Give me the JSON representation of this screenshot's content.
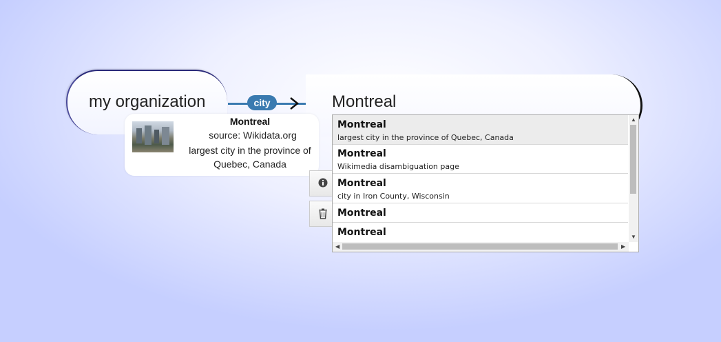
{
  "source_node": {
    "label": "my organization"
  },
  "edge": {
    "label": "city"
  },
  "target_node": {
    "label": "Montreal"
  },
  "info_card": {
    "title": "Montreal",
    "source": "source: Wikidata.org",
    "description": "largest city in the province of Quebec, Canada",
    "thumbnail": "city-skyline-image"
  },
  "side_buttons": [
    {
      "icon": "info-icon"
    },
    {
      "icon": "trash-icon"
    }
  ],
  "suggestions": [
    {
      "title": "Montreal",
      "description": "largest city in the province of Quebec, Canada",
      "selected": true
    },
    {
      "title": "Montreal",
      "description": "Wikimedia disambiguation page"
    },
    {
      "title": "Montreal",
      "description": "city in Iron County, Wisconsin"
    },
    {
      "title": "Montreal",
      "description": ""
    },
    {
      "title": "Montreal",
      "description": ""
    }
  ],
  "colors": {
    "edge": "#3a7ab0",
    "background_edge": "#c6cfff",
    "selected_row": "#ececec"
  }
}
